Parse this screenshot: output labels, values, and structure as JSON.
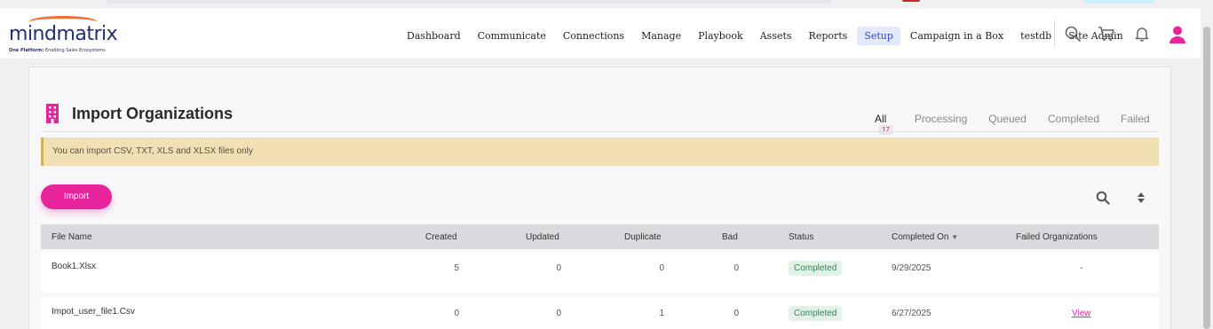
{
  "app": {
    "logo_word": "mindmatrix",
    "logo_tag_bold": "One Platform:",
    "logo_tag_rest": " Enabling Sales Ecosystems"
  },
  "nav": {
    "items": [
      "Dashboard",
      "Communicate",
      "Connections",
      "Manage",
      "Playbook",
      "Assets",
      "Reports",
      "Setup",
      "Campaign in a Box",
      "testdb",
      "Site Admin"
    ],
    "active": "Setup"
  },
  "header_icons": [
    "search-icon",
    "cart-icon",
    "bell-icon",
    "user-icon"
  ],
  "colors": {
    "accent": "#e8249c",
    "brand": "#1f2f7a",
    "active_nav": "#3447c4",
    "completed": "#2e8a55"
  },
  "page": {
    "title": "Import Organizations",
    "tabs": [
      {
        "label": "All",
        "count": "17"
      },
      {
        "label": "Processing"
      },
      {
        "label": "Queued"
      },
      {
        "label": "Completed"
      },
      {
        "label": "Failed"
      }
    ],
    "active_tab": "All",
    "alert": "You can import CSV, TXT, XLS and XLSX files only",
    "import_button": "Import"
  },
  "table": {
    "columns": [
      "File Name",
      "Created",
      "Updated",
      "Duplicate",
      "Bad",
      "Status",
      "Completed On",
      "Failed Organizations"
    ],
    "sorted_column": "Completed On",
    "rows": [
      {
        "file": "Book1.Xlsx",
        "created": "5",
        "updated": "0",
        "duplicate": "0",
        "bad": "0",
        "status": "Completed",
        "completed_on": "9/29/2025",
        "failed": "-"
      },
      {
        "file": "Impot_user_file1.Csv",
        "created": "0",
        "updated": "0",
        "duplicate": "1",
        "bad": "0",
        "status": "Completed",
        "completed_on": "6/27/2025",
        "failed": "View"
      }
    ]
  }
}
